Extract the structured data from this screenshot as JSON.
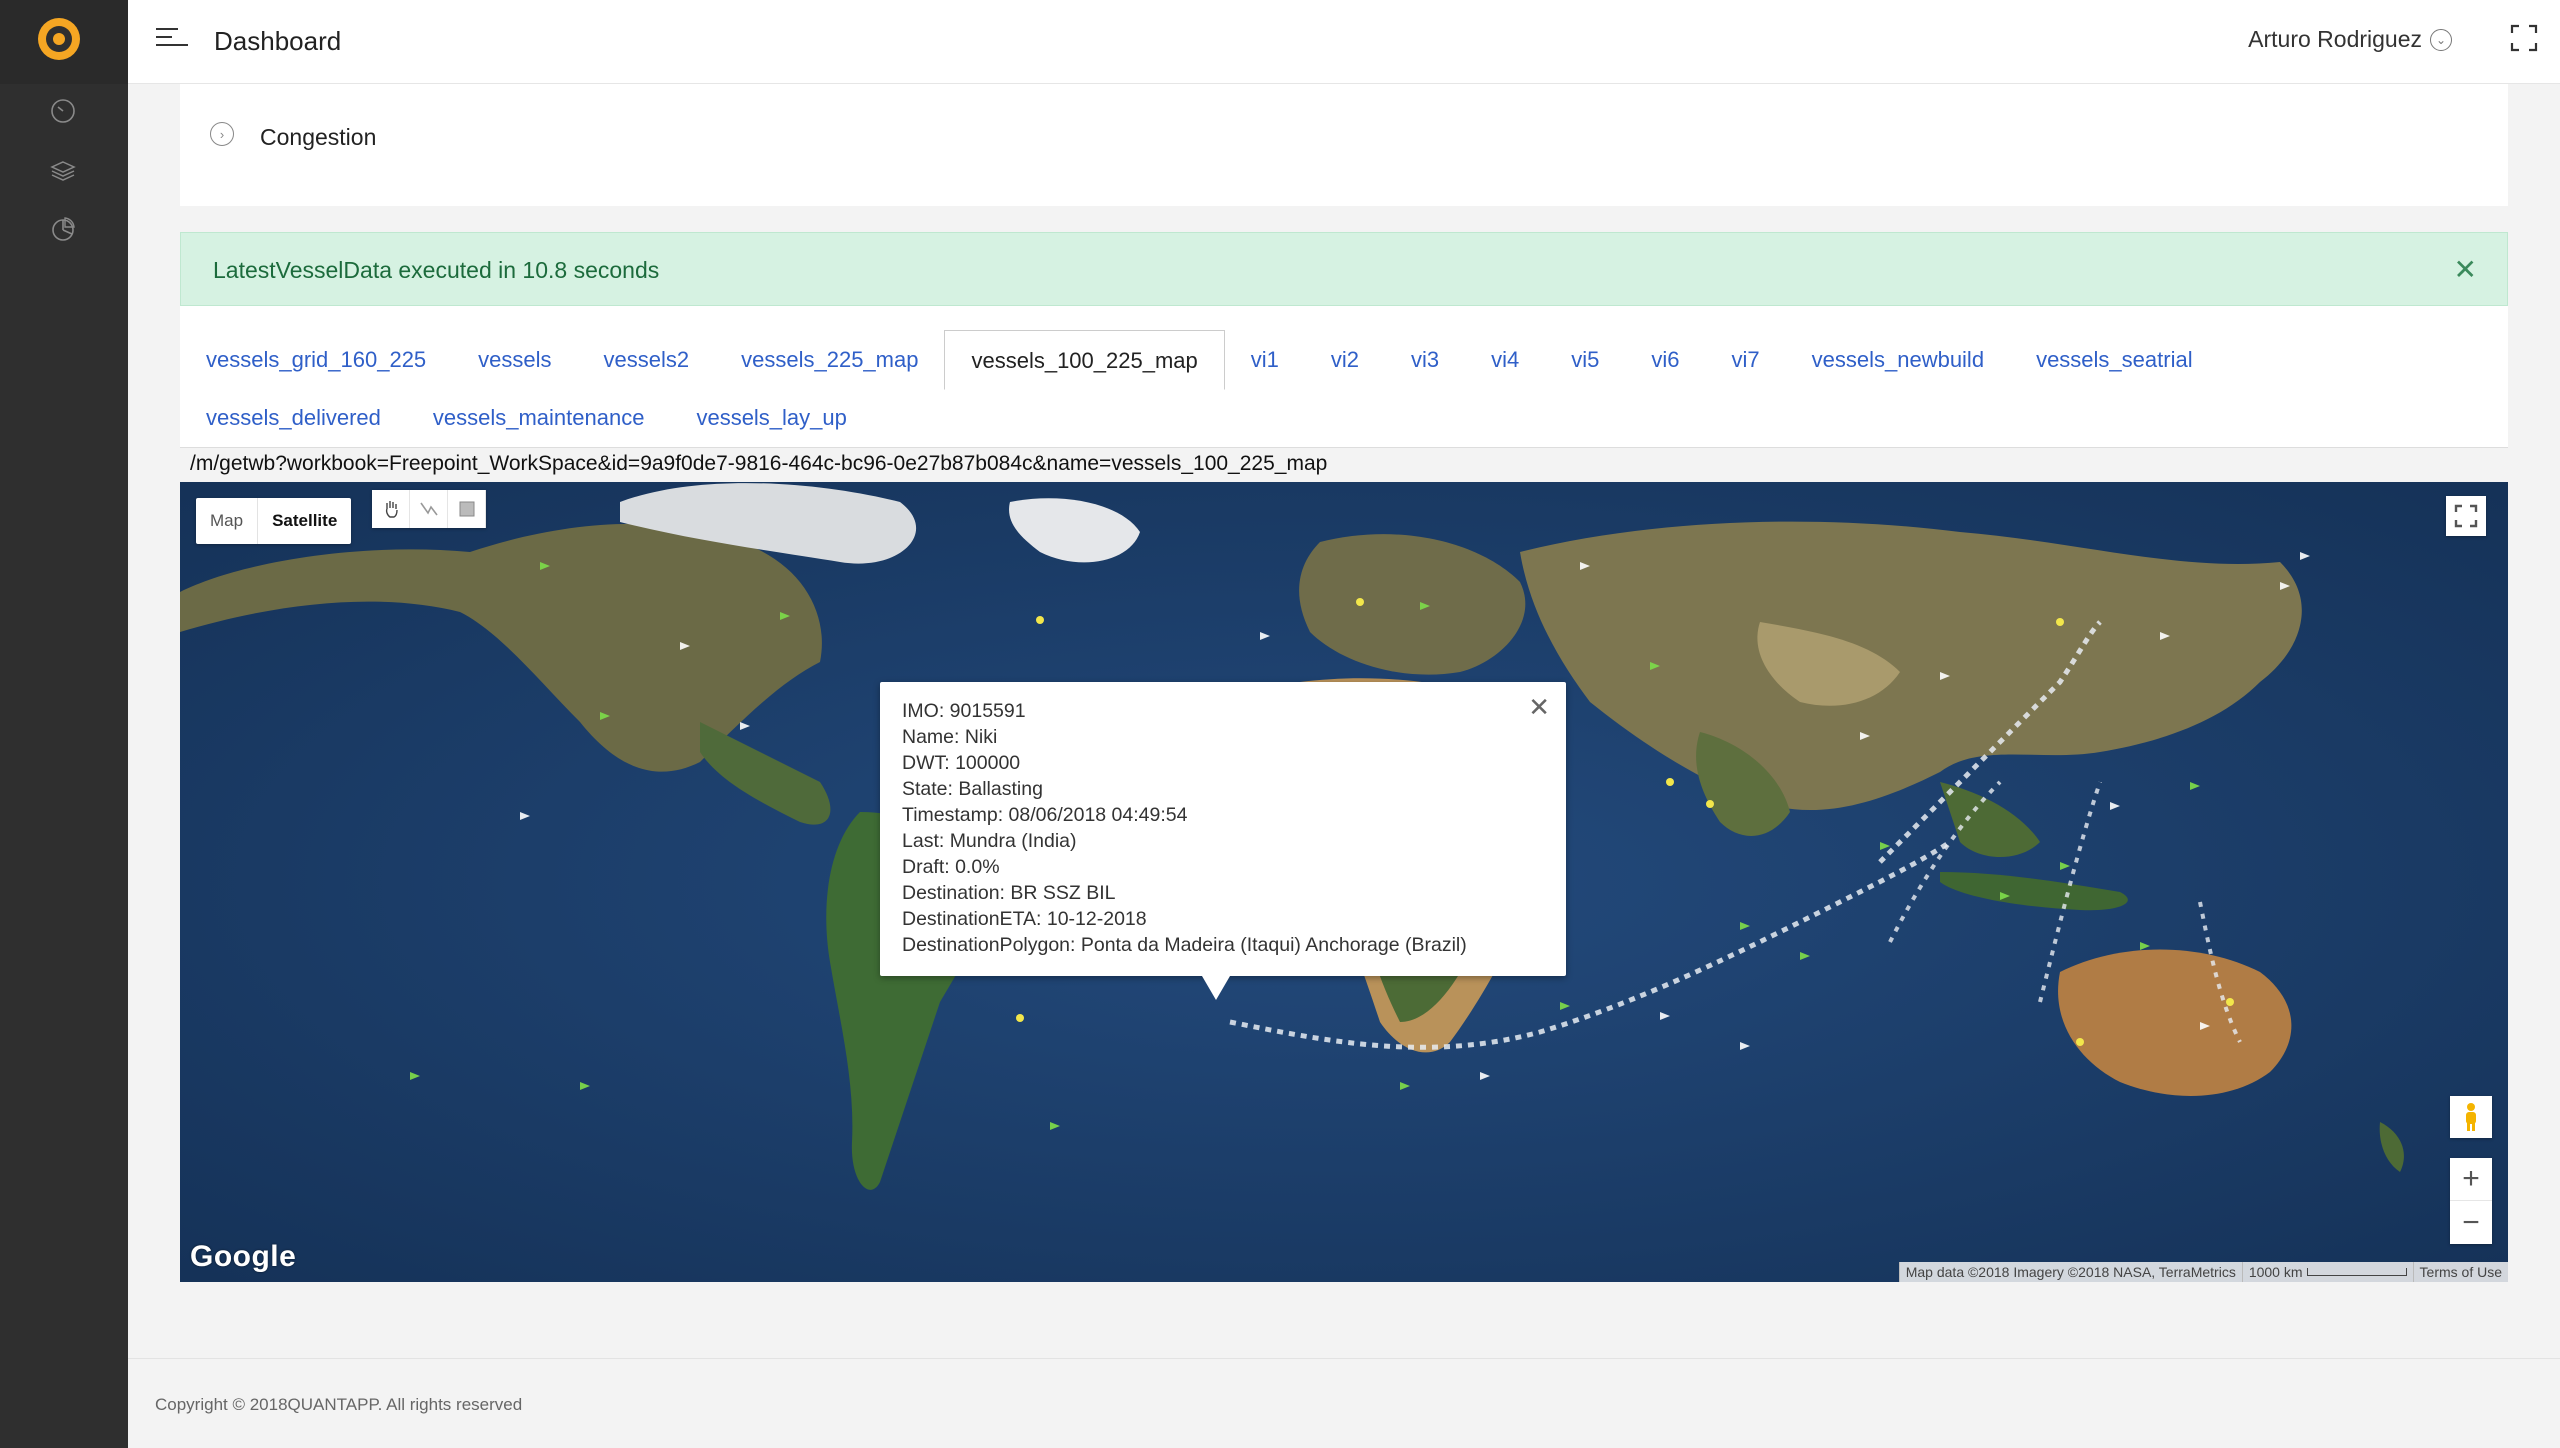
{
  "header": {
    "title": "Dashboard",
    "user_name": "Arturo Rodriguez"
  },
  "sidebar": {
    "icons": [
      "logo-icon",
      "gauge-icon",
      "layers-icon",
      "pie-chart-icon"
    ]
  },
  "panel": {
    "label": "Congestion"
  },
  "alert": {
    "message": "LatestVesselData executed in 10.8 seconds",
    "close": "✕"
  },
  "tabs": {
    "row1": [
      "vessels_grid_160_225",
      "vessels",
      "vessels2",
      "vessels_225_map",
      "vessels_100_225_map",
      "vi1",
      "vi2",
      "vi3",
      "vi4",
      "vi5",
      "vi6",
      "vi7",
      "vessels_newbuild",
      "vessels_seatrial"
    ],
    "row2": [
      "vessels_delivered",
      "vessels_maintenance",
      "vessels_lay_up"
    ],
    "active": "vessels_100_225_map"
  },
  "url": "/m/getwb?workbook=Freepoint_WorkSpace&id=9a9f0de7-9816-464c-bc96-0e27b87b084c&name=vessels_100_225_map",
  "map": {
    "type_map": "Map",
    "type_satellite": "Satellite",
    "google_logo": "Google",
    "attribution": "Map data ©2018 Imagery ©2018 NASA, TerraMetrics",
    "scale": "1000 km",
    "terms": "Terms of Use",
    "zoom_in": "+",
    "zoom_out": "−"
  },
  "popup": {
    "lines": [
      "IMO: 9015591",
      "Name: Niki",
      "DWT: 100000",
      "State: Ballasting",
      "Timestamp: 08/06/2018 04:49:54",
      "Last: Mundra (India)",
      "Draft: 0.0%",
      "Destination: BR SSZ BIL",
      "DestinationETA: 10-12-2018",
      "DestinationPolygon: Ponta da Madeira (Itaqui) Anchorage (Brazil)"
    ],
    "close": "✕"
  },
  "footer": {
    "text": "Copyright © 2018QUANTAPP. All rights reserved"
  },
  "colors": {
    "sidebar": "#2f2f2f",
    "accent": "#f5a623",
    "link": "#2f5fc8",
    "alert_bg": "#d6f2e2",
    "ocean": "#1c3f6e"
  }
}
